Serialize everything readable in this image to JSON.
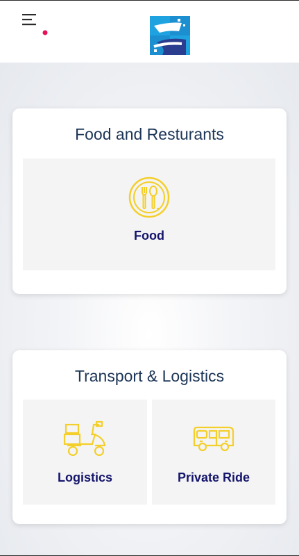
{
  "colors": {
    "accent_dot": "#e3125b",
    "icon_yellow": "#f4cf2a",
    "title_color": "#1c3556",
    "label_color": "#14146b",
    "logo_blue_light": "#1ea3e0",
    "logo_blue_dark": "#2b3d8f"
  },
  "header": {
    "menu_icon": "hamburger-menu-icon",
    "logo_icon": "app-logo"
  },
  "sections": {
    "food": {
      "title": "Food and Resturants",
      "tiles": [
        {
          "label": "Food",
          "icon": "fork-spoon-icon"
        }
      ]
    },
    "transport": {
      "title": "Transport & Logistics",
      "tiles": [
        {
          "label": "Logistics",
          "icon": "delivery-scooter-icon"
        },
        {
          "label": "Private Ride",
          "icon": "van-icon"
        }
      ]
    }
  }
}
